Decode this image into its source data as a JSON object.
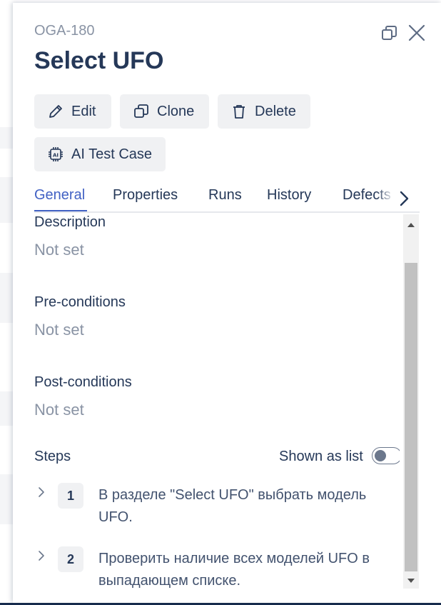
{
  "case": {
    "key": "OGA-180",
    "title": "Select UFO"
  },
  "actions": {
    "edit": "Edit",
    "clone": "Clone",
    "delete": "Delete",
    "ai": "AI Test Case"
  },
  "tabs": [
    {
      "label": "General",
      "active": true
    },
    {
      "label": "Properties"
    },
    {
      "label": "Runs"
    },
    {
      "label": "History"
    },
    {
      "label": "Defects"
    }
  ],
  "fields": [
    {
      "label": "Description",
      "value": "Not set"
    },
    {
      "label": "Pre-conditions",
      "value": "Not set"
    },
    {
      "label": "Post-conditions",
      "value": "Not set"
    }
  ],
  "steps_section": {
    "label": "Steps",
    "toggle_label": "Shown as list",
    "toggle_on": false,
    "items": [
      {
        "number": "1",
        "text": "В разделе \"Select UFO\" выбрать модель UFO."
      },
      {
        "number": "2",
        "text": "Проверить наличие всех моделей UFO в выпадающем списке."
      }
    ]
  },
  "icons": {
    "restore": "restore-window-icon",
    "close": "close-icon",
    "edit": "pencil-icon",
    "clone": "copy-icon",
    "delete": "trash-icon",
    "ai": "ai-chip-icon",
    "tabs_next": "chevron-right-icon",
    "step_expand": "chevron-right-icon"
  },
  "colors": {
    "accent": "#4262c4",
    "text": "#253858",
    "muted": "#8993a4",
    "button_bg": "#f0f1f3"
  }
}
